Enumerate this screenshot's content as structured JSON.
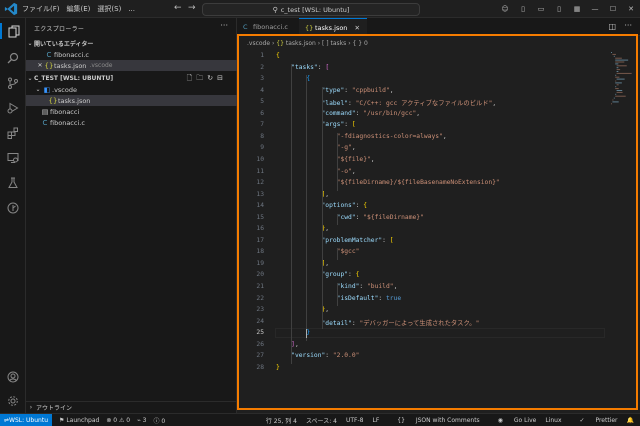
{
  "titlebar": {
    "menus": [
      "ファイル(F)",
      "編集(E)",
      "選択(S)",
      "..."
    ],
    "search_text": "c_test [WSL: Ubuntu]"
  },
  "sidebar": {
    "header": "エクスプローラー",
    "open_editors_label": "開いているエディター",
    "open_editors": [
      {
        "name": "fibonacci.c",
        "detail": ""
      },
      {
        "name": "tasks.json",
        "detail": ".vscode"
      }
    ],
    "workspace_label": "C_TEST [WSL: UBUNTU]",
    "tree": [
      {
        "name": ".vscode",
        "kind": "folder"
      },
      {
        "name": "tasks.json",
        "kind": "json"
      },
      {
        "name": "fibonacci",
        "kind": "file"
      },
      {
        "name": "fibonacci.c",
        "kind": "c"
      }
    ],
    "outline_label": "アウトライン"
  },
  "tabs": [
    {
      "label": "fibonacci.c",
      "active": false
    },
    {
      "label": "tasks.json",
      "active": true
    }
  ],
  "breadcrumb": [
    ".vscode",
    "tasks.json",
    "[ ] tasks",
    "{ } 0"
  ],
  "editor": {
    "current_line": 25,
    "lines": [
      "{",
      "    \"tasks\": [",
      "        {",
      "            \"type\": \"cppbuild\",",
      "            \"label\": \"C/C++: gcc アクティブなファイルのビルド\",",
      "            \"command\": \"/usr/bin/gcc\",",
      "            \"args\": [",
      "                \"-fdiagnostics-color=always\",",
      "                \"-g\",",
      "                \"${file}\",",
      "                \"-o\",",
      "                \"${fileDirname}/${fileBasenameNoExtension}\"",
      "            ],",
      "            \"options\": {",
      "                \"cwd\": \"${fileDirname}\"",
      "            },",
      "            \"problemMatcher\": [",
      "                \"$gcc\"",
      "            ],",
      "            \"group\": {",
      "                \"kind\": \"build\",",
      "                \"isDefault\": true",
      "            },",
      "            \"detail\": \"デバッガーによって生成されたタスク。\"",
      "        }",
      "    ],",
      "    \"version\": \"2.0.0\"",
      "}"
    ]
  },
  "statusbar": {
    "remote": "WSL: Ubuntu",
    "launchpad": "Launchpad",
    "problems": "⊗ 0 ⚠ 0",
    "ports": "3",
    "info": "0",
    "position": "行 25, 列 4",
    "spaces": "スペース: 4",
    "encoding": "UTF-8",
    "eol": "LF",
    "language": "JSON with Comments",
    "golive": "Go Live",
    "os": "Linux",
    "prettier": "Prettier"
  }
}
